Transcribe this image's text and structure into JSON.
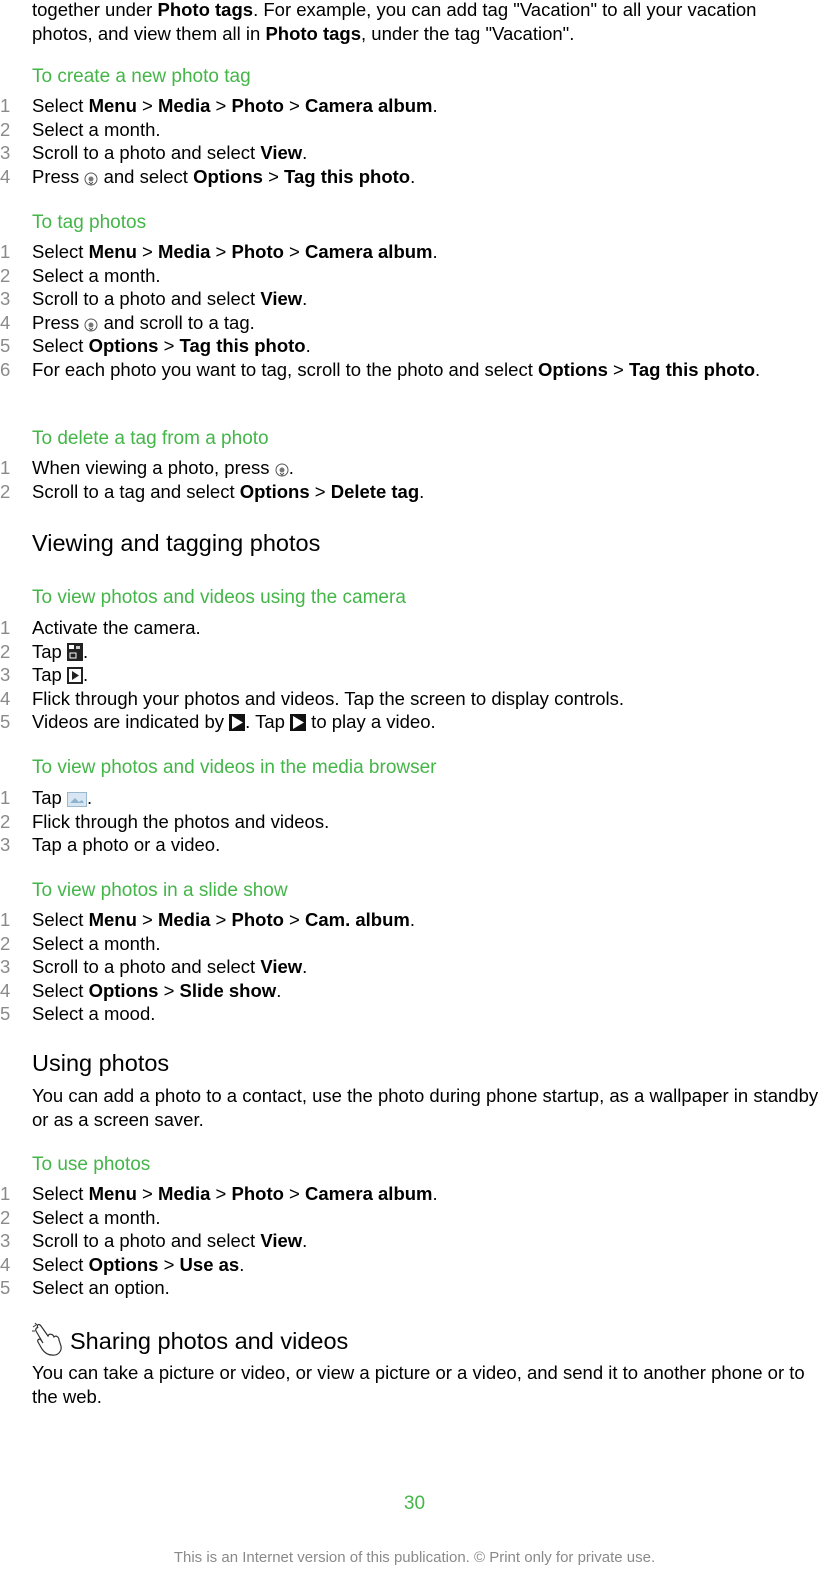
{
  "intro": {
    "p1": "together under ",
    "b1": "Photo tags",
    "p2": ". For example, you can add tag \"Vacation\" to all your vacation",
    "p3": "photos, and view them all in ",
    "b2": "Photo tags",
    "p4": ", under the tag \"Vacation\"."
  },
  "create_tag": {
    "title": "To create a new photo tag",
    "steps": [
      {
        "n": "1",
        "t": [
          "Select ",
          {
            "b": "Menu"
          },
          " > ",
          {
            "b": "Media"
          },
          " > ",
          {
            "b": "Photo"
          },
          " > ",
          {
            "b": "Camera album"
          },
          "."
        ]
      },
      {
        "n": "2",
        "t": [
          "Select a month."
        ]
      },
      {
        "n": "3",
        "t": [
          "Scroll to a photo and select ",
          {
            "b": "View"
          },
          "."
        ]
      },
      {
        "n": "4",
        "t": [
          "Press ",
          {
            "i": "nav-key"
          },
          " and select ",
          {
            "b": "Options"
          },
          " > ",
          {
            "b": "Tag this photo"
          },
          "."
        ]
      }
    ]
  },
  "tag_photos": {
    "title": "To tag photos",
    "steps": [
      {
        "n": "1",
        "t": [
          "Select ",
          {
            "b": "Menu"
          },
          " > ",
          {
            "b": "Media"
          },
          " > ",
          {
            "b": "Photo"
          },
          " > ",
          {
            "b": "Camera album"
          },
          "."
        ]
      },
      {
        "n": "2",
        "t": [
          "Select a month."
        ]
      },
      {
        "n": "3",
        "t": [
          "Scroll to a photo and select ",
          {
            "b": "View"
          },
          "."
        ]
      },
      {
        "n": "4",
        "t": [
          "Press ",
          {
            "i": "nav-key"
          },
          " and scroll to a tag."
        ]
      },
      {
        "n": "5",
        "t": [
          "Select ",
          {
            "b": "Options"
          },
          " > ",
          {
            "b": "Tag this photo"
          },
          "."
        ]
      },
      {
        "n": "6",
        "t": [
          "For each photo you want to tag, scroll to the photo and select ",
          {
            "b": "Options"
          },
          " > ",
          {
            "b": "Tag this photo"
          },
          "."
        ]
      }
    ]
  },
  "delete_tag": {
    "title": "To delete a tag from a photo",
    "steps": [
      {
        "n": "1",
        "t": [
          "When viewing a photo, press ",
          {
            "i": "nav-key"
          },
          "."
        ]
      },
      {
        "n": "2",
        "t": [
          "Scroll to a tag and select ",
          {
            "b": "Options"
          },
          " > ",
          {
            "b": "Delete tag"
          },
          "."
        ]
      }
    ]
  },
  "viewing_heading": "Viewing and tagging photos",
  "view_camera": {
    "title": "To view photos and videos using the camera",
    "steps": [
      {
        "n": "1",
        "t": [
          "Activate the camera."
        ]
      },
      {
        "n": "2",
        "t": [
          "Tap ",
          {
            "i": "camera-mode"
          },
          "."
        ]
      },
      {
        "n": "3",
        "t": [
          "Tap ",
          {
            "i": "playback"
          },
          "."
        ]
      },
      {
        "n": "4",
        "t": [
          "Flick through your photos and videos. Tap the screen to display controls."
        ]
      },
      {
        "n": "5",
        "t": [
          "Videos are indicated by ",
          {
            "i": "play"
          },
          ". Tap ",
          {
            "i": "play"
          },
          " to play a video."
        ]
      }
    ]
  },
  "view_browser": {
    "title": "To view photos and videos in the media browser",
    "steps": [
      {
        "n": "1",
        "t": [
          "Tap ",
          {
            "i": "media-browser"
          },
          "."
        ]
      },
      {
        "n": "2",
        "t": [
          "Flick through the photos and videos."
        ]
      },
      {
        "n": "3",
        "t": [
          "Tap a photo or a video."
        ]
      }
    ]
  },
  "slide_show": {
    "title": "To view photos in a slide show",
    "steps": [
      {
        "n": "1",
        "t": [
          "Select ",
          {
            "b": "Menu"
          },
          " > ",
          {
            "b": "Media"
          },
          " > ",
          {
            "b": "Photo"
          },
          " > ",
          {
            "b": "Cam. album"
          },
          "."
        ]
      },
      {
        "n": "2",
        "t": [
          "Select a month."
        ]
      },
      {
        "n": "3",
        "t": [
          "Scroll to a photo and select ",
          {
            "b": "View"
          },
          "."
        ]
      },
      {
        "n": "4",
        "t": [
          "Select ",
          {
            "b": "Options"
          },
          " > ",
          {
            "b": "Slide show"
          },
          "."
        ]
      },
      {
        "n": "5",
        "t": [
          "Select a mood."
        ]
      }
    ]
  },
  "using_heading": "Using photos",
  "using_text": "You can add a photo to a contact, use the photo during phone startup, as a wallpaper in standby or as a screen saver.",
  "use_photos": {
    "title": "To use photos",
    "steps": [
      {
        "n": "1",
        "t": [
          "Select ",
          {
            "b": "Menu"
          },
          " > ",
          {
            "b": "Media"
          },
          " > ",
          {
            "b": "Photo"
          },
          " > ",
          {
            "b": "Camera album"
          },
          "."
        ]
      },
      {
        "n": "2",
        "t": [
          "Select a month."
        ]
      },
      {
        "n": "3",
        "t": [
          "Scroll to a photo and select ",
          {
            "b": "View"
          },
          "."
        ]
      },
      {
        "n": "4",
        "t": [
          "Select ",
          {
            "b": "Options"
          },
          " > ",
          {
            "b": "Use as"
          },
          "."
        ]
      },
      {
        "n": "5",
        "t": [
          "Select an option."
        ]
      }
    ]
  },
  "sharing_heading": "Sharing photos and videos",
  "sharing_text": "You can take a picture or video, or view a picture or a video, and send it to another phone or to the web.",
  "footer": {
    "page_number": "30",
    "notice": "This is an Internet version of this publication. © Print only for private use."
  },
  "colors": {
    "accent": "#44b649",
    "step_number": "#8a8a8a"
  }
}
